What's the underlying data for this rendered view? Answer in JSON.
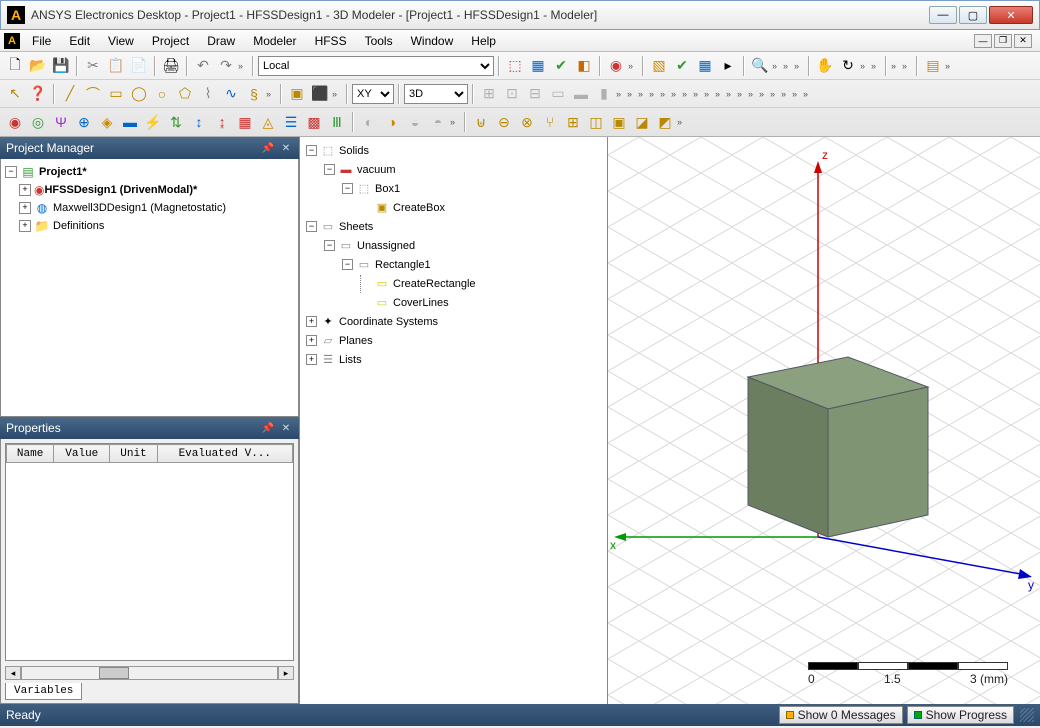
{
  "title": "ANSYS Electronics Desktop - Project1 - HFSSDesign1 - 3D Modeler - [Project1 - HFSSDesign1 - Modeler]",
  "menu": [
    "File",
    "Edit",
    "View",
    "Project",
    "Draw",
    "Modeler",
    "HFSS",
    "Tools",
    "Window",
    "Help"
  ],
  "combo_scope": "Local",
  "combo_plane": "XY",
  "combo_view": "3D",
  "panels": {
    "project_manager": "Project Manager",
    "properties": "Properties"
  },
  "project_tree": {
    "root": "Project1*",
    "design1": "HFSSDesign1 (DrivenModal)*",
    "design2": "Maxwell3DDesign1 (Magnetostatic)",
    "definitions": "Definitions"
  },
  "prop_headers": [
    "Name",
    "Value",
    "Unit",
    "Evaluated V..."
  ],
  "prop_tab": "Variables",
  "model_tree": {
    "solids": "Solids",
    "vacuum": "vacuum",
    "box1": "Box1",
    "createbox": "CreateBox",
    "sheets": "Sheets",
    "unassigned": "Unassigned",
    "rect1": "Rectangle1",
    "createrect": "CreateRectangle",
    "coverlines": "CoverLines",
    "coordsys": "Coordinate Systems",
    "planes": "Planes",
    "lists": "Lists"
  },
  "axes": {
    "x": "x",
    "y": "y",
    "z": "z"
  },
  "scale": {
    "start": "0",
    "mid": "1.5",
    "end": "3 (mm)"
  },
  "status": {
    "ready": "Ready",
    "messages": "Show 0 Messages",
    "progress": "Show Progress"
  },
  "icons": {
    "new": "🗋",
    "open": "📂",
    "save": "💾",
    "cut": "✂",
    "copy": "📋",
    "paste": "📄",
    "print": "🖨",
    "undo": "↶",
    "redo": "↷",
    "validate": "✔",
    "analyze": "▦",
    "field": "◧",
    "mesh": "▨",
    "solve": "⚙",
    "zoom": "🔍",
    "pan": "✋",
    "rotate": "↻",
    "fit": "⛶",
    "box": "▭",
    "cyl": "◯",
    "cone": "△",
    "sphere": "○",
    "torus": "◎",
    "line": "╱",
    "rect": "▢",
    "poly": "⬠",
    "ellipse": "⬭",
    "cs": "✦",
    "plane": "▱",
    "unite": "⊎",
    "subtract": "⊖",
    "intersect": "⊗",
    "split": "⑂",
    "help": "?",
    "whats": "❓"
  }
}
